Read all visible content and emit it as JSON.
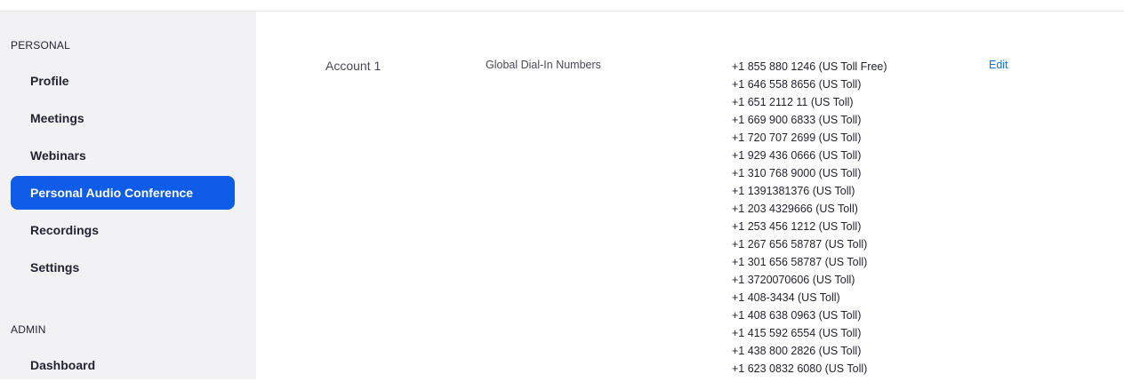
{
  "sidebar": {
    "personal_title": "PERSONAL",
    "items": [
      {
        "label": "Profile"
      },
      {
        "label": "Meetings"
      },
      {
        "label": "Webinars"
      },
      {
        "label": "Personal Audio Conference",
        "active": true
      },
      {
        "label": "Recordings"
      },
      {
        "label": "Settings"
      }
    ],
    "admin_title": "ADMIN",
    "admin_items": [
      {
        "label": "Dashboard"
      }
    ]
  },
  "main": {
    "row": {
      "account": "Account 1",
      "type": "Global Dial-In Numbers",
      "edit_label": "Edit",
      "numbers": [
        "+1 855 880 1246 (US Toll Free)",
        "+1 646 558 8656 (US Toll)",
        "+1 651 2112 11 (US Toll)",
        "+1 669 900 6833 (US Toll)",
        "+1 720 707 2699 (US Toll)",
        "+1 929 436 0666 (US Toll)",
        "+1 310 768 9000 (US Toll)",
        "+1 1391381376 (US Toll)",
        "+1 203 4329666 (US Toll)",
        "+1 253 456 1212 (US Toll)",
        "+1 267 656 58787 (US Toll)",
        "+1 301 656 58787 (US Toll)",
        "+1 3720070606 (US Toll)",
        "+1 408-3434 (US Toll)",
        "+1 408 638 0963 (US Toll)",
        "+1 415 592 6554 (US Toll)",
        "+1 438 800 2826 (US Toll)",
        "+1 623 0832 6080 (US Toll)"
      ]
    }
  },
  "colors": {
    "accent": "#0e5ce7",
    "link": "#0e72ed",
    "sidebar_bg": "#f2f2f5"
  }
}
